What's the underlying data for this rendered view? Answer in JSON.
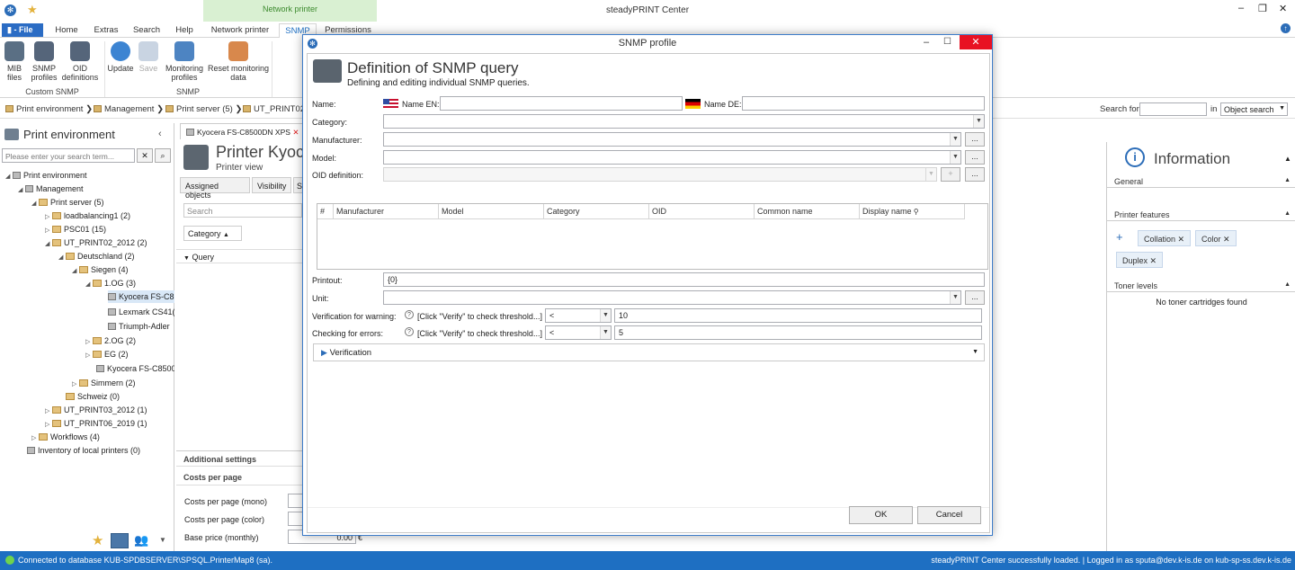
{
  "app": {
    "title": "steadyPRINT Center"
  },
  "ribbon": {
    "file_label": "File",
    "tabs": [
      "Home",
      "Extras",
      "Search",
      "Help",
      "Network printer",
      "SNMP",
      "Permissions"
    ],
    "context_group": "Network printer",
    "buttons": {
      "mib": "MIB files",
      "snmp_profiles": "SNMP profiles",
      "oid": "OID definitions",
      "update": "Update",
      "save": "Save",
      "monitoring": "Monitoring profiles",
      "reset": "Reset monitoring data"
    },
    "groups": {
      "custom": "Custom SNMP",
      "snmp": "SNMP"
    }
  },
  "breadcrumb": [
    "Print environment",
    "Management",
    "Print server (5)",
    "UT_PRINT02_"
  ],
  "search": {
    "label": "Search for",
    "in": "in",
    "scope": "Object search"
  },
  "left": {
    "title": "Print environment",
    "search_placeholder": "Please enter your search term...",
    "tree": [
      {
        "label": "Print environment"
      },
      {
        "label": "Management"
      },
      {
        "label": "Print server (5)"
      },
      {
        "label": "loadbalancing1 (2)"
      },
      {
        "label": "PSC01 (15)"
      },
      {
        "label": "UT_PRINT02_2012 (2)"
      },
      {
        "label": "Deutschland (2)"
      },
      {
        "label": "Siegen (4)"
      },
      {
        "label": "1.OG (3)"
      },
      {
        "label": "Kyocera FS-C8"
      },
      {
        "label": "Lexmark CS41("
      },
      {
        "label": "Triumph-Adler"
      },
      {
        "label": "2.OG (2)"
      },
      {
        "label": "EG (2)"
      },
      {
        "label": "Kyocera FS-C8500"
      },
      {
        "label": "Simmern (2)"
      },
      {
        "label": "Schweiz (0)"
      },
      {
        "label": "UT_PRINT03_2012 (1)"
      },
      {
        "label": "UT_PRINT06_2019 (1)"
      },
      {
        "label": "Workflows (4)"
      },
      {
        "label": "Inventory of local printers (0)"
      }
    ]
  },
  "mid": {
    "tab": "Kyocera FS-C8500DN XPS",
    "title": "Printer Kyoce",
    "subtitle": "Printer view",
    "subtabs": [
      "Assigned objects",
      "Visibility",
      "S"
    ],
    "search_placeholder": "Search",
    "category": "Category",
    "query": "Query",
    "additional": "Additional settings",
    "costs": "Costs per page",
    "cost_mono": "Costs per page (mono)",
    "cost_color": "Costs per page (color)",
    "base_price": "Base price (monthly)",
    "base_value": "0.00",
    "currency": "€"
  },
  "info": {
    "title": "Information",
    "general": "General",
    "features": "Printer features",
    "chips": [
      "Collation",
      "Color",
      "Duplex"
    ],
    "toner": "Toner levels",
    "toner_empty": "No toner cartridges found"
  },
  "dialog": {
    "window_title": "SNMP profile",
    "heading": "Definition of SNMP query",
    "subheading": "Defining and editing individual SNMP queries.",
    "name_label": "Name:",
    "name_en": "Name EN:",
    "name_de": "Name DE:",
    "category": "Category:",
    "manufacturer": "Manufacturer:",
    "model": "Model:",
    "oid": "OID definition:",
    "columns": [
      "#",
      "Manufacturer",
      "Model",
      "Category",
      "OID",
      "Common name",
      "Display name"
    ],
    "printout_label": "Printout:",
    "printout_value": "{0}",
    "unit": "Unit:",
    "warn_label": "Verification for warning:",
    "err_label": "Checking for errors:",
    "hint": "[Click \"Verify\" to check threshold...]",
    "op": "<",
    "warn_value": "10",
    "err_value": "5",
    "verification": "Verification",
    "ok": "OK",
    "cancel": "Cancel"
  },
  "status": {
    "left": "Connected to database KUB-SPDBSERVER\\SPSQL.PrinterMap8 (sa).",
    "right": "steadyPRINT Center successfully loaded. | Logged in as sputa@dev.k-is.de on kub-sp-ss.dev.k-is.de"
  },
  "colors": {
    "accent": "#1e6fc2",
    "context": "#d9f0d2",
    "close": "#e81123"
  }
}
